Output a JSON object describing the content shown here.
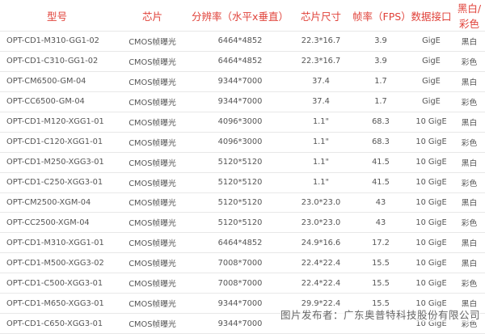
{
  "table": {
    "headers": [
      "型号",
      "芯片",
      "分辨率（水平x垂直）",
      "芯片尺寸",
      "帧率（FPS）",
      "数据接口",
      "黑白/彩色"
    ],
    "rows": [
      [
        "OPT-CD1-M310-GG1-02",
        "CMOS帧曝光",
        "6464*4852",
        "22.3*16.7",
        "3.9",
        "GigE",
        "黑白"
      ],
      [
        "OPT-CD1-C310-GG1-02",
        "CMOS帧曝光",
        "6464*4852",
        "22.3*16.7",
        "3.9",
        "GigE",
        "彩色"
      ],
      [
        "OPT-CM6500-GM-04",
        "CMOS帧曝光",
        "9344*7000",
        "37.4",
        "1.7",
        "GigE",
        "黑白"
      ],
      [
        "OPT-CC6500-GM-04",
        "CMOS帧曝光",
        "9344*7000",
        "37.4",
        "1.7",
        "GigE",
        "彩色"
      ],
      [
        "OPT-CD1-M120-XGG1-01",
        "CMOS帧曝光",
        "4096*3000",
        "1.1\"",
        "68.3",
        "10 GigE",
        "黑白"
      ],
      [
        "OPT-CD1-C120-XGG1-01",
        "CMOS帧曝光",
        "4096*3000",
        "1.1\"",
        "68.3",
        "10 GigE",
        "彩色"
      ],
      [
        "OPT-CD1-M250-XGG3-01",
        "CMOS帧曝光",
        "5120*5120",
        "1.1\"",
        "41.5",
        "10 GigE",
        "黑白"
      ],
      [
        "OPT-CD1-C250-XGG3-01",
        "CMOS帧曝光",
        "5120*5120",
        "1.1\"",
        "41.5",
        "10 GigE",
        "彩色"
      ],
      [
        "OPT-CM2500-XGM-04",
        "CMOS帧曝光",
        "5120*5120",
        "23.0*23.0",
        "43",
        "10 GigE",
        "黑白"
      ],
      [
        "OPT-CC2500-XGM-04",
        "CMOS帧曝光",
        "5120*5120",
        "23.0*23.0",
        "43",
        "10 GigE",
        "彩色"
      ],
      [
        "OPT-CD1-M310-XGG1-01",
        "CMOS帧曝光",
        "6464*4852",
        "24.9*16.6",
        "17.2",
        "10 GigE",
        "黑白"
      ],
      [
        "OPT-CD1-M500-XGG3-02",
        "CMOS帧曝光",
        "7008*7000",
        "22.4*22.4",
        "15.5",
        "10 GigE",
        "黑白"
      ],
      [
        "OPT-CD1-C500-XGG3-01",
        "CMOS帧曝光",
        "7008*7000",
        "22.4*22.4",
        "15.5",
        "10 GigE",
        "彩色"
      ],
      [
        "OPT-CD1-M650-XGG3-01",
        "CMOS帧曝光",
        "9344*7000",
        "29.9*22.4",
        "15.5",
        "10 GigE",
        "黑白"
      ],
      [
        "OPT-CD1-C650-XGG3-01",
        "CMOS帧曝光",
        "9344*7000",
        "",
        "",
        "10 GigE",
        "彩色"
      ]
    ]
  },
  "watermark": "图片发布者：广东奥普特科技股份有限公司"
}
